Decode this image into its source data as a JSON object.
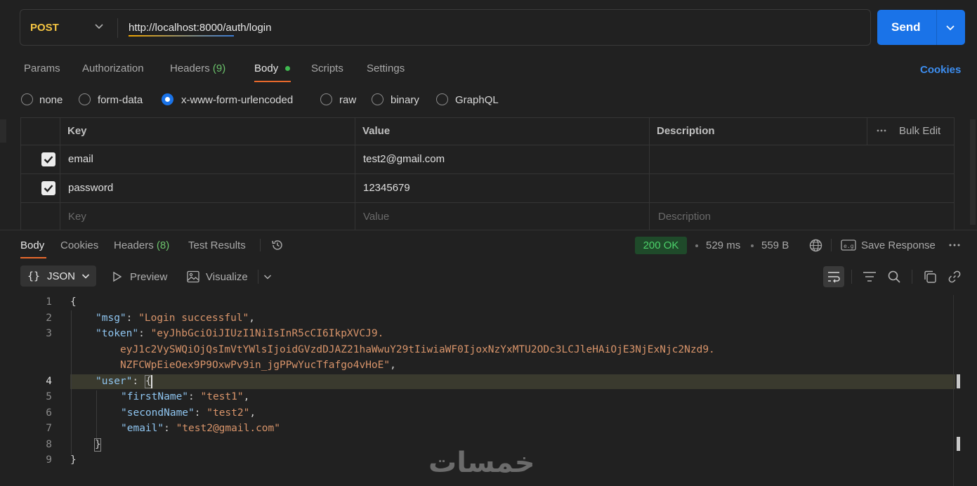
{
  "request": {
    "method": "POST",
    "url": "http://localhost:8000/auth/login",
    "send_label": "Send"
  },
  "request_tabs": [
    {
      "label": "Params"
    },
    {
      "label": "Authorization"
    },
    {
      "label": "Headers",
      "count": "(9)"
    },
    {
      "label": "Body"
    },
    {
      "label": "Scripts"
    },
    {
      "label": "Settings"
    }
  ],
  "cookies_label": "Cookies",
  "body_types": [
    "none",
    "form-data",
    "x-www-form-urlencoded",
    "raw",
    "binary",
    "GraphQL"
  ],
  "selected_body_type": "x-www-form-urlencoded",
  "params_table": {
    "headers": {
      "key": "Key",
      "value": "Value",
      "description": "Description",
      "bulk_edit": "Bulk Edit"
    },
    "rows": [
      {
        "checked": true,
        "key": "email",
        "value": "test2@gmail.com",
        "description": ""
      },
      {
        "checked": true,
        "key": "password",
        "value": "12345679",
        "description": ""
      }
    ],
    "placeholders": {
      "key": "Key",
      "value": "Value",
      "description": "Description"
    }
  },
  "response_tabs": [
    {
      "label": "Body"
    },
    {
      "label": "Cookies"
    },
    {
      "label": "Headers",
      "count": "(8)"
    },
    {
      "label": "Test Results"
    }
  ],
  "response_meta": {
    "status": "200 OK",
    "time": "529 ms",
    "size": "559 B",
    "save_response": "Save Response"
  },
  "response_toolbar": {
    "format": "JSON",
    "preview": "Preview",
    "visualize": "Visualize"
  },
  "code": {
    "line_numbers": [
      "1",
      "2",
      "3",
      "4",
      "5",
      "6",
      "7",
      "8",
      "9"
    ],
    "open_brace": "{",
    "close_brace": "}",
    "msg_key": "\"msg\"",
    "msg_value": "\"Login successful\"",
    "token_key": "\"token\"",
    "token_line1": "\"eyJhbGciOiJIUzI1NiIsInR5cCI6IkpXVCJ9.",
    "token_line2": "eyJ1c2VySWQiOjQsImVtYWlsIjoidGVzdDJAZ21haWwuY29tIiwiaWF0IjoxNzYxMTU2ODc3LCJleHAiOjE3NjExNjc2Nzd9.",
    "token_line3": "NZFCWpEieOex9P9OxwPv9in_jgPPwYucTfafgo4vHoE\"",
    "user_key": "\"user\"",
    "first_name_key": "\"firstName\"",
    "first_name_value": "\"test1\"",
    "second_name_key": "\"secondName\"",
    "second_name_value": "\"test2\"",
    "email_key": "\"email\"",
    "email_value": "\"test2@gmail.com\""
  },
  "watermark": "خمسات",
  "colors": {
    "accent": "#1a73e8",
    "tab_indicator": "#e8692c",
    "status_ok": "#4cd16a",
    "method": "#f5c542"
  }
}
